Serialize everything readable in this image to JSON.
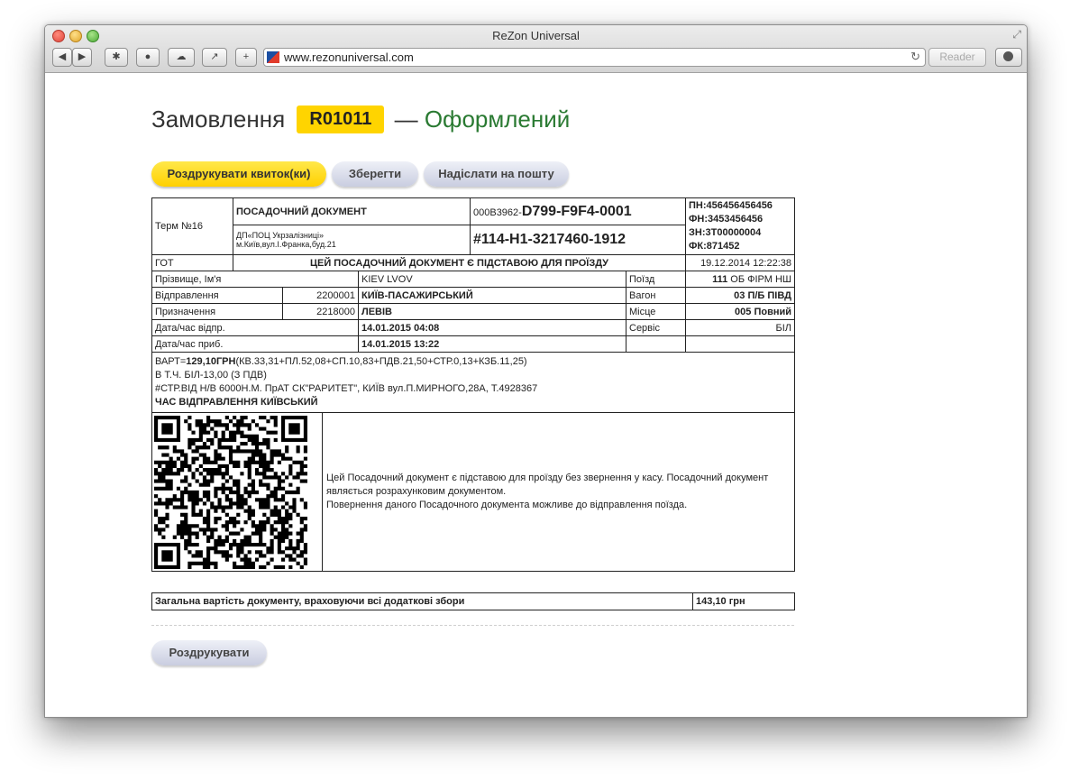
{
  "window": {
    "title": "ReZon Universal"
  },
  "browser": {
    "url": "www.rezonuniversal.com",
    "reader_label": "Reader",
    "add_tab": "+"
  },
  "order": {
    "title_prefix": "Замовлення",
    "code": "R01011",
    "dash": "—",
    "status": "Оформлений"
  },
  "actions": {
    "print_tickets": "Роздрукувати квиток(ки)",
    "save": "Зберегти",
    "send_email": "Надіслати на пошту"
  },
  "ticket": {
    "term": "Терм №16",
    "doc_type": "ПОСАДОЧНИЙ ДОКУМЕНТ",
    "issuer_line1": "ДП«ПОЦ Укрзалізниці»",
    "issuer_line2": "м.Київ,вул.І.Франка,буд.21",
    "doc_prefix": "000В3962-",
    "doc_number": "D799-F9F4-0001",
    "doc_number2": "#114-H1-3217460-1912",
    "fiscal": [
      "ПН:456456456456",
      "ФН:3453456456",
      "ЗН:3Т00000004",
      "ФК:871452"
    ],
    "got": "ГОТ",
    "basis": "ЦЕЙ ПОСАДОЧНИЙ ДОКУМЕНТ Є ПІДСТАВОЮ ДЛЯ ПРОЇЗДУ",
    "issued_at": "19.12.2014 12:22:38",
    "passenger_label": "Прізвище, Ім'я",
    "passenger": "KIEV LVOV",
    "train_label": "Поїзд",
    "train_num": "111",
    "train_firm": "ОБ ФІРМ НШ",
    "departure_label": "Відправлення",
    "departure_code": "2200001",
    "departure_station": "КИЇВ-ПАСАЖИРСЬКИЙ",
    "wagon_label": "Вагон",
    "wagon": "03 П/Б ПІВД",
    "destination_label": "Призначення",
    "destination_code": "2218000",
    "destination_station": "ЛЕВІВ",
    "seat_label": "Місце",
    "seat": "005 Повний",
    "dep_time_label": "Дата/час відпр.",
    "dep_time": "14.01.2015 04:08",
    "service_label": "Сервіс",
    "service": "БІЛ",
    "arr_time_label": "Дата/час приб.",
    "arr_time": "14.01.2015 13:22",
    "price_prefix": "ВАРТ=",
    "price_value": "129,10ГРН",
    "price_breakdown": "(КВ.33,31+ПЛ.52,08+СП.10,83+ПДВ.21,50+СТР.0,13+КЗБ.11,25)",
    "vat_line": "В Т.Ч. БІЛ-13,00 (З ПДВ)",
    "insurance_line": "#СТР.ВІД Н/В 6000Н.М. ПрАТ СК\"РАРИТЕТ\", КИЇВ вул.П.МИРНОГО,28А, Т.4928367",
    "time_note": "ЧАС ВІДПРАВЛЕННЯ КИЇВСЬКИЙ",
    "note_line1": "Цей Посадочний документ є підставою для проїзду без звернення у касу. Посадочний документ",
    "note_line2": "являється розрахунковим документом.",
    "note_line3": "Повернення даного Посадочного документа можливе до відправлення поїзда."
  },
  "total": {
    "label": "Загальна вартість документу, враховуючи всі додаткові збори",
    "value": "143,10 грн"
  },
  "footer": {
    "print": "Роздрукувати"
  },
  "colors": {
    "accent_yellow": "#ffd400",
    "status_green": "#2a7a32"
  }
}
